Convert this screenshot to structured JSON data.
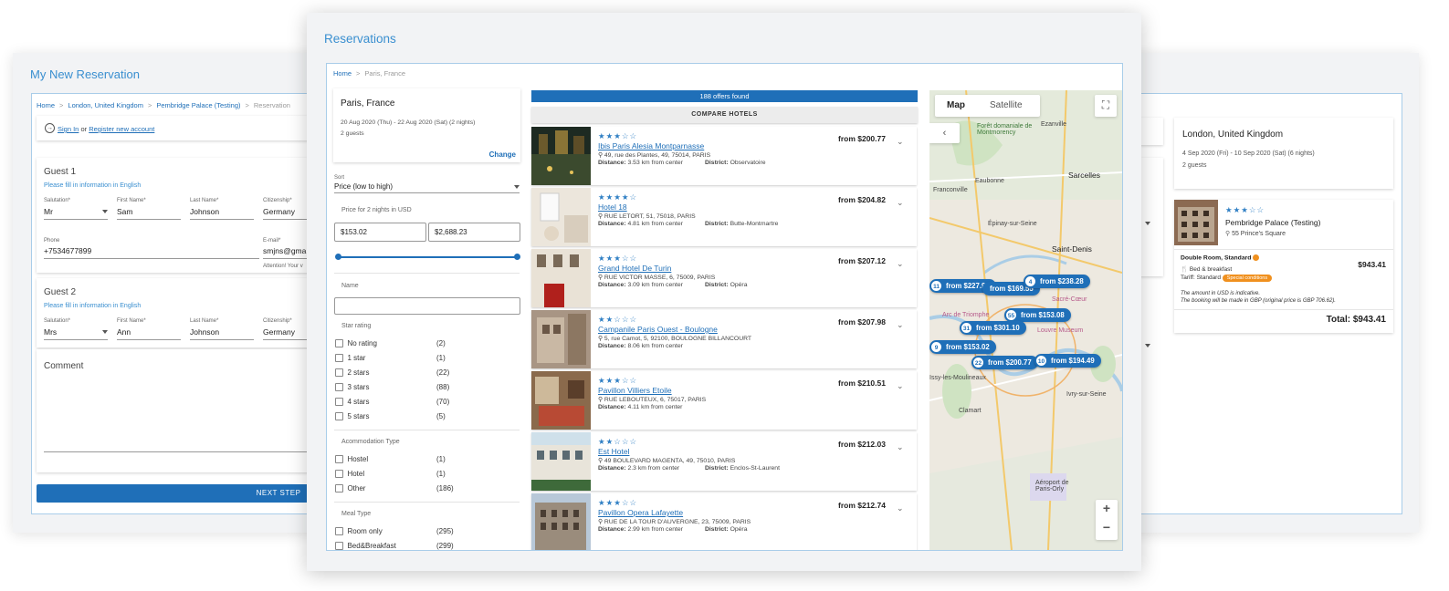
{
  "left_window": {
    "title": "My New Reservation",
    "breadcrumb": [
      "Home",
      "London, United Kingdom",
      "Pembridge Palace (Testing)",
      "Reservation"
    ],
    "sign_in": "Sign In",
    "or_text": "or",
    "register": "Register new account",
    "guest1": {
      "title": "Guest 1",
      "hint": "Please fill in information in English",
      "salutation_label": "Salutation*",
      "salutation": "Mr",
      "first_label": "First Name*",
      "first": "Sam",
      "last_label": "Last Name*",
      "last": "Johnson",
      "cit_label": "Citizenship*",
      "cit": "Germany",
      "phone_label": "Phone",
      "phone": "+7534677899",
      "email_label": "E-mail*",
      "email": "smjns@gma",
      "email_note": "Attention! Your v"
    },
    "guest2": {
      "title": "Guest 2",
      "hint": "Please fill in information in English",
      "salutation_label": "Salutation*",
      "salutation": "Mrs",
      "first_label": "First Name*",
      "first": "Ann",
      "last_label": "Last Name*",
      "last": "Johnson",
      "cit_label": "Citizenship*",
      "cit": "Germany"
    },
    "comment_title": "Comment",
    "next_button": "NEXT STEP"
  },
  "right_window": {
    "city": "London, United Kingdom",
    "dates": "4 Sep 2020 (Fri) - 10 Sep 2020 (Sat) (6 nights)",
    "guests": "2 guests",
    "hotel_stars": "★★★☆☆",
    "hotel_name": "Pembridge Palace (Testing)",
    "hotel_address": "55 Prince's Square",
    "room": "Double Room, Standard",
    "meal": "Bed & breakfast",
    "tariff_label": "Tariff: Standard",
    "special": "Special conditions",
    "room_price": "$943.41",
    "note1": "The amount in USD is indicative.",
    "note2": "The booking will be made in GBP (original price is GBP 706.62).",
    "total": "Total: $943.41"
  },
  "main_window": {
    "title": "Reservations",
    "breadcrumb": [
      "Home",
      "Paris, France"
    ],
    "search": {
      "city": "Paris, France",
      "dates": "20 Aug 2020 (Thu) - 22 Aug 2020 (Sat) (2 nights)",
      "guests": "2 guests",
      "change": "Change"
    },
    "sort": {
      "label": "Sort",
      "value": "Price (low to high)"
    },
    "price": {
      "label": "Price for 2 nights in USD",
      "min": "$153.02",
      "max": "$2,688.23"
    },
    "name_filter": {
      "label": "Name",
      "value": ""
    },
    "star_rating": {
      "label": "Star rating",
      "options": [
        {
          "label": "No rating",
          "count": "(2)"
        },
        {
          "label": "1 star",
          "count": "(1)"
        },
        {
          "label": "2 stars",
          "count": "(22)"
        },
        {
          "label": "3 stars",
          "count": "(88)"
        },
        {
          "label": "4 stars",
          "count": "(70)"
        },
        {
          "label": "5 stars",
          "count": "(5)"
        }
      ]
    },
    "accommodation": {
      "label": "Acommodation Type",
      "options": [
        {
          "label": "Hostel",
          "count": "(1)"
        },
        {
          "label": "Hotel",
          "count": "(1)"
        },
        {
          "label": "Other",
          "count": "(186)"
        }
      ]
    },
    "meal": {
      "label": "Meal Type",
      "options": [
        {
          "label": "Room only",
          "count": "(295)"
        },
        {
          "label": "Bed&Breakfast",
          "count": "(299)"
        }
      ]
    },
    "offers_found": "188 offers found",
    "compare": "COMPARE HOTELS",
    "hotels": [
      {
        "stars": "★★★☆☆",
        "name": "Ibis Paris Alesia Montparnasse",
        "address": "49, rue des Plantes, 49, 75014, PARIS",
        "distance": "3.53  km from center",
        "district": "Observatoire",
        "price": "from $200.77"
      },
      {
        "stars": "★★★★☆",
        "name": "Hotel 18",
        "address": "RUE LETORT, 51, 75018, PARIS",
        "distance": "4.81  km from center",
        "district": "Butte-Montmartre",
        "price": "from $204.82"
      },
      {
        "stars": "★★★☆☆",
        "name": "Grand Hotel De Turin",
        "address": "RUE VICTOR MASSE, 6, 75009, PARIS",
        "distance": "3.09  km from center",
        "district": "Opéra",
        "price": "from $207.12"
      },
      {
        "stars": "★★☆☆☆",
        "name": "Campanile Paris Ouest - Boulogne",
        "address": "5, rue Camot, 5, 92100, BOULOGNE BILLANCOURT",
        "distance": "8.06  km from center",
        "district": "",
        "price": "from $207.98"
      },
      {
        "stars": "★★★☆☆",
        "name": "Pavillon Villiers Etoile",
        "address": "RUE LEBOUTEUX, 6, 75017, PARIS",
        "distance": "4.11  km from center",
        "district": "",
        "price": "from $210.51"
      },
      {
        "stars": "★★☆☆☆",
        "name": "Est Hotel",
        "address": "49 BOULEVARD MAGENTA, 49, 75010, PARIS",
        "distance": "2.3  km from center",
        "district": "Enclos-St-Laurent",
        "price": "from $212.03"
      },
      {
        "stars": "★★★☆☆",
        "name": "Pavillon Opera Lafayette",
        "address": "RUE DE LA TOUR D'AUVERGNE, 23, 75009, PARIS",
        "distance": "2.99  km from center",
        "district": "Opéra",
        "price": "from $212.74"
      }
    ],
    "distance_label": "Distance:",
    "district_label": "District:",
    "map": {
      "tab_map": "Map",
      "tab_satellite": "Satellite",
      "labels": [
        "Ezanville",
        "Forêt domaniale de Montmorency",
        "Sarcelles",
        "Franconville",
        "Eaubonne",
        "Épinay-sur-Seine",
        "Saint-Denis",
        "Sacré-Cœur",
        "Arc de Triomphe",
        "Louvre Museum",
        "Issy-les-Moulineaux",
        "Ivry-sur-Seine",
        "Clamart",
        "Aéroport de Paris-Orly"
      ],
      "pins": [
        {
          "n": "11",
          "label": "from $227.98"
        },
        {
          "n": "",
          "label": "from $169.55"
        },
        {
          "n": "4",
          "label": "from $238.28"
        },
        {
          "n": "55",
          "label": "from $153.08"
        },
        {
          "n": "31",
          "label": "from $301.10"
        },
        {
          "n": "9",
          "label": "from $153.02"
        },
        {
          "n": "22",
          "label": "from $200.77"
        },
        {
          "n": "10",
          "label": "from $194.49"
        }
      ],
      "zoom_in": "+",
      "zoom_out": "−"
    }
  },
  "colors": {
    "accent": "#1f6fb8",
    "title_blue": "#3a8fd0",
    "orange": "#f0901e"
  }
}
